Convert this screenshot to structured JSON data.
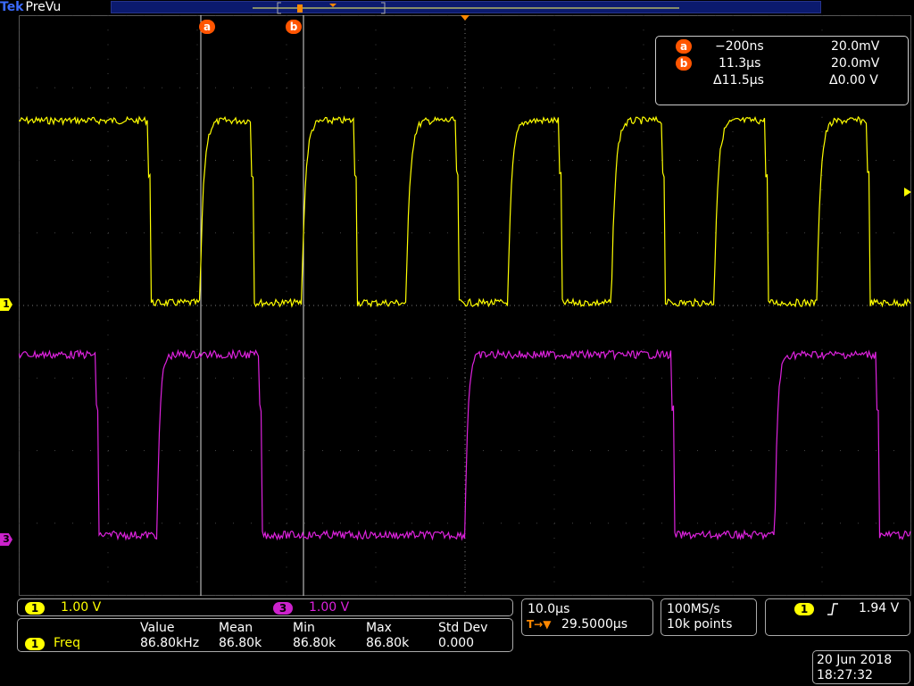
{
  "brand": {
    "vendor": "Tek",
    "mode": "PreVu"
  },
  "cursors": {
    "a": {
      "label": "a",
      "time": "−200ns",
      "value": "20.0mV"
    },
    "b": {
      "label": "b",
      "time": "11.3µs",
      "value": "20.0mV"
    },
    "delta_time": "Δ11.5µs",
    "delta_value": "Δ0.00 V"
  },
  "channels": {
    "ch1": {
      "number": "1",
      "scale": "1.00 V",
      "color": "#ffff00"
    },
    "ch3": {
      "number": "3",
      "scale": "1.00 V",
      "color": "#cc22cc"
    }
  },
  "timebase": {
    "scale": "10.0µs",
    "delay_icon": "T→▼",
    "position": "29.5000µs"
  },
  "acquisition": {
    "rate": "100MS/s",
    "points": "10k points"
  },
  "trigger": {
    "source": "1",
    "slope_icon": "rising-edge-icon",
    "level": "1.94 V"
  },
  "measurement": {
    "channel": "1",
    "name": "Freq",
    "headers": [
      "Value",
      "Mean",
      "Min",
      "Max",
      "Std Dev"
    ],
    "values": [
      "86.80kHz",
      "86.80k",
      "86.80k",
      "86.80k",
      "0.000"
    ]
  },
  "datetime": {
    "date": "20 Jun 2018",
    "time": "18:27:32"
  },
  "colors": {
    "cursor_tag": "#ff5500",
    "graticule": "#555555",
    "record_bar": "#0b1a6e"
  }
}
